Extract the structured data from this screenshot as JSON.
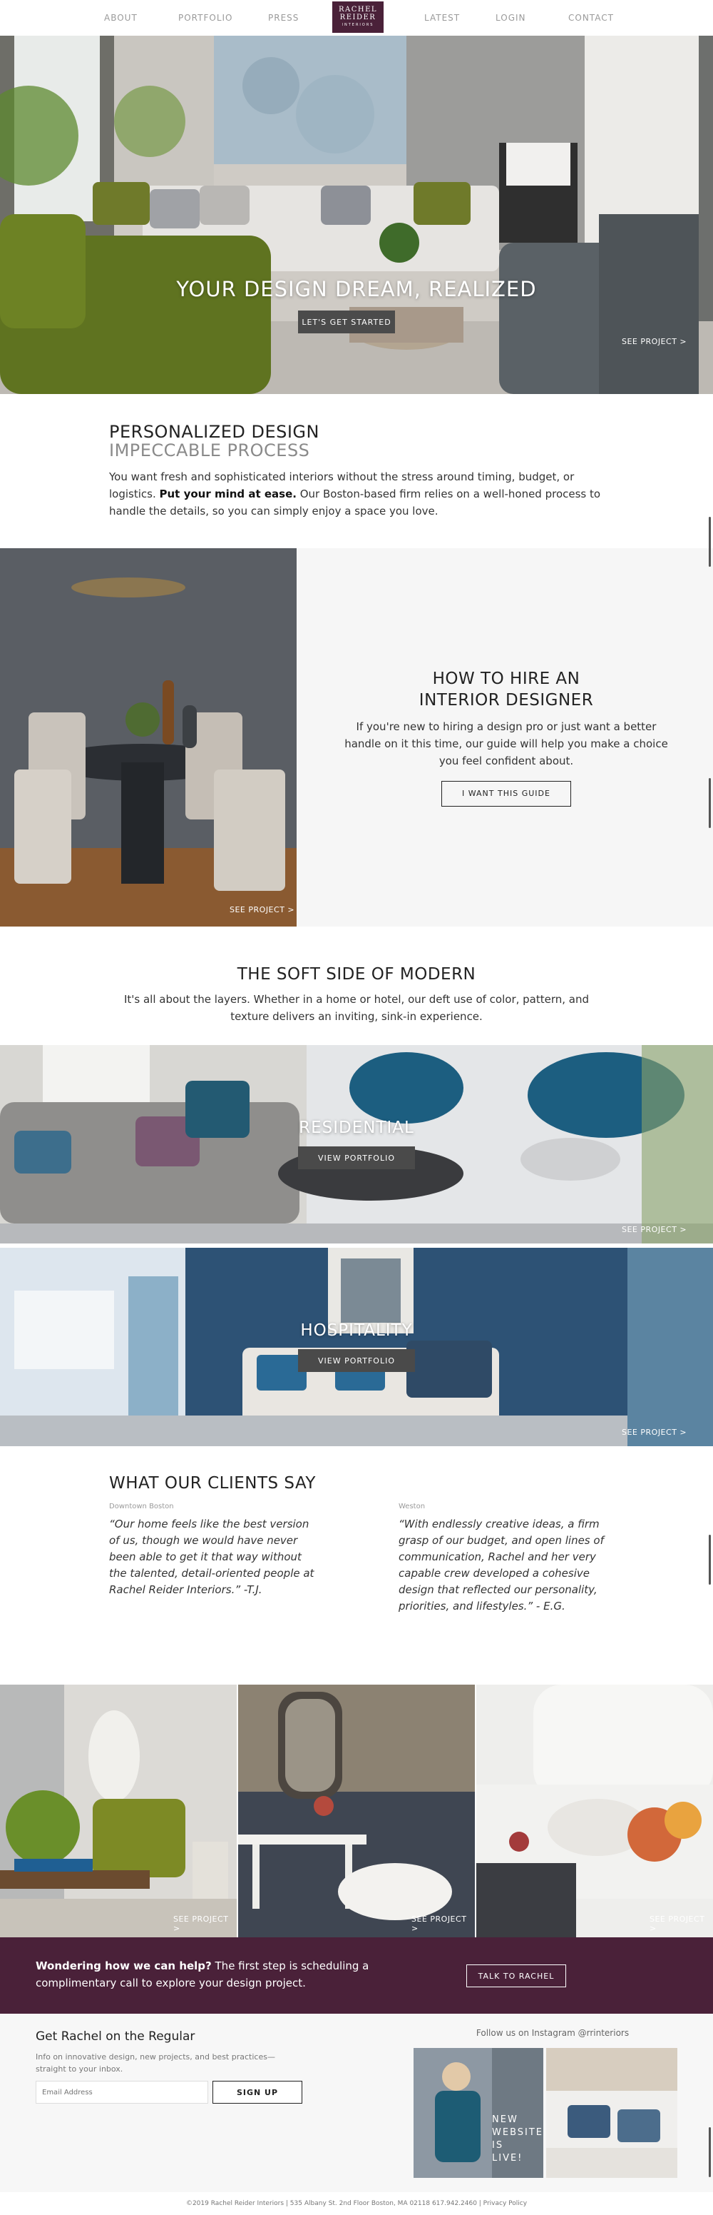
{
  "nav": {
    "left": [
      "ABOUT",
      "PORTFOLIO",
      "PRESS"
    ],
    "right": [
      "LATEST",
      "LOGIN",
      "CONTACT"
    ],
    "logo": {
      "line1": "RACHEL",
      "line2": "REIDER",
      "line3": "INTERIORS"
    }
  },
  "hero": {
    "title": "YOUR DESIGN DREAM, REALIZED",
    "button": "LET'S GET STARTED",
    "see_project": "SEE PROJECT >"
  },
  "personalized": {
    "title": "PERSONALIZED DESIGN",
    "subtitle": "IMPECCABLE PROCESS",
    "text1": "You want fresh and sophisticated interiors without the stress around timing, budget, or logistics. ",
    "bold": "Put your mind at ease.",
    "text2": " Our Boston-based firm relies on a well-honed process to handle the details, so you can simply enjoy a space you love."
  },
  "hire": {
    "title_line1": "HOW TO HIRE AN",
    "title_line2": "INTERIOR DESIGNER",
    "text": "If you're new to hiring a design pro or just want a better handle on it this time, our guide will help you make a choice you feel confident about.",
    "button": "I WANT THIS GUIDE",
    "see_project": "SEE PROJECT >"
  },
  "soft_side": {
    "title": "THE SOFT SIDE OF MODERN",
    "text": "It's all about the layers. Whether in a home or hotel, our deft use of color, pattern, and texture delivers an inviting, sink-in experience."
  },
  "portfolio": {
    "residential": {
      "title": "RESIDENTIAL",
      "button": "VIEW PORTFOLIO",
      "see_project": "SEE PROJECT >"
    },
    "hospitality": {
      "title": "HOSPITALITY",
      "button": "VIEW PORTFOLIO",
      "see_project": "SEE PROJECT >"
    }
  },
  "clients": {
    "title": "WHAT OUR CLIENTS SAY",
    "testimonials": [
      {
        "location": "Downtown Boston",
        "quote": "“Our home feels like the best version of us, though we would have never been able to get it that way without the talented, detail-oriented people at Rachel Reider Interiors.” -T.J."
      },
      {
        "location": "Weston",
        "quote": "“With endlessly creative ideas, a firm grasp of our budget, and open lines of communication, Rachel and her very capable crew developed a cohesive design that reflected our personality, priorities, and lifestyles.” - E.G."
      }
    ]
  },
  "gallery": {
    "see_project": "SEE PROJECT >"
  },
  "cta": {
    "bold": "Wondering how we can help?",
    "text": " The first step is scheduling a complimentary call to explore your design project.",
    "button": "TALK TO RACHEL"
  },
  "newsletter": {
    "title": "Get Rachel on the Regular",
    "desc": "Info on innovative design, new projects, and best practices—straight to your inbox.",
    "placeholder": "Email Address",
    "button": "SIGN UP"
  },
  "instagram": {
    "label": "Follow us on Instagram @rrinteriors",
    "post_text": "NEW WEBSITE IS LIVE!"
  },
  "footer": {
    "text": "©2019 Rachel Reider Interiors | 535 Albany St. 2nd Floor Boston, MA 02118 617.942.2460 | Privacy Policy"
  }
}
